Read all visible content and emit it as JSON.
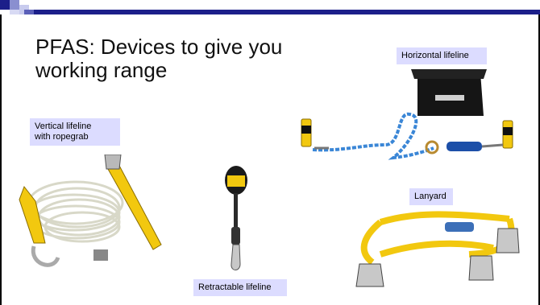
{
  "slide": {
    "title_line1": "PFAS: Devices to give you",
    "title_line2": "working range"
  },
  "labels": {
    "horizontal": "Horizontal lifeline",
    "vertical_line1": "Vertical lifeline",
    "vertical_line2": "with ropegrab",
    "lanyard": "Lanyard",
    "retractable": "Retractable lifeline"
  },
  "colors": {
    "accent": "#1c1f8a",
    "label_bg": "#dcdcff",
    "webbing": "#f2c80f"
  }
}
